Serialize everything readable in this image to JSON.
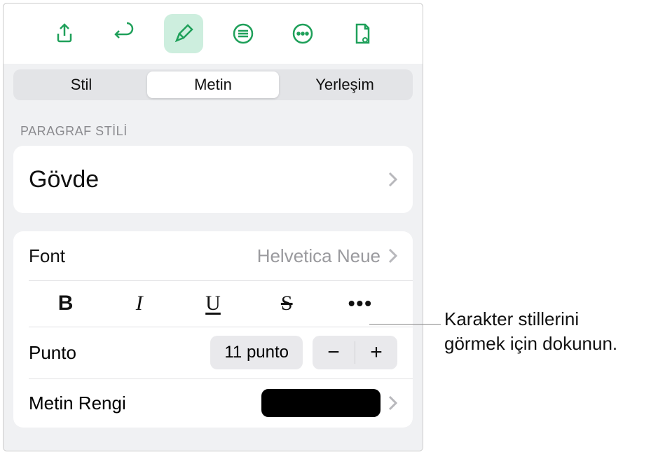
{
  "toolbar": {
    "icons": [
      "share-icon",
      "undo-icon",
      "brush-icon",
      "insert-icon",
      "more-icon",
      "document-view-icon"
    ],
    "active": "brush-icon"
  },
  "tabs": {
    "items": [
      {
        "label": "Stil"
      },
      {
        "label": "Metin"
      },
      {
        "label": "Yerleşim"
      }
    ],
    "active_index": 1
  },
  "paragraph": {
    "section_label": "PARAGRAF STİLİ",
    "style_name": "Gövde"
  },
  "font": {
    "label": "Font",
    "value": "Helvetica Neue",
    "style_buttons": {
      "bold": "B",
      "italic": "I",
      "underline": "U",
      "strike": "S"
    }
  },
  "size": {
    "label": "Punto",
    "value": "11 punto",
    "minus": "−",
    "plus": "+"
  },
  "color": {
    "label": "Metin Rengi",
    "value": "#000000"
  },
  "callout": {
    "text": "Karakter stillerini görmek için dokunun."
  }
}
